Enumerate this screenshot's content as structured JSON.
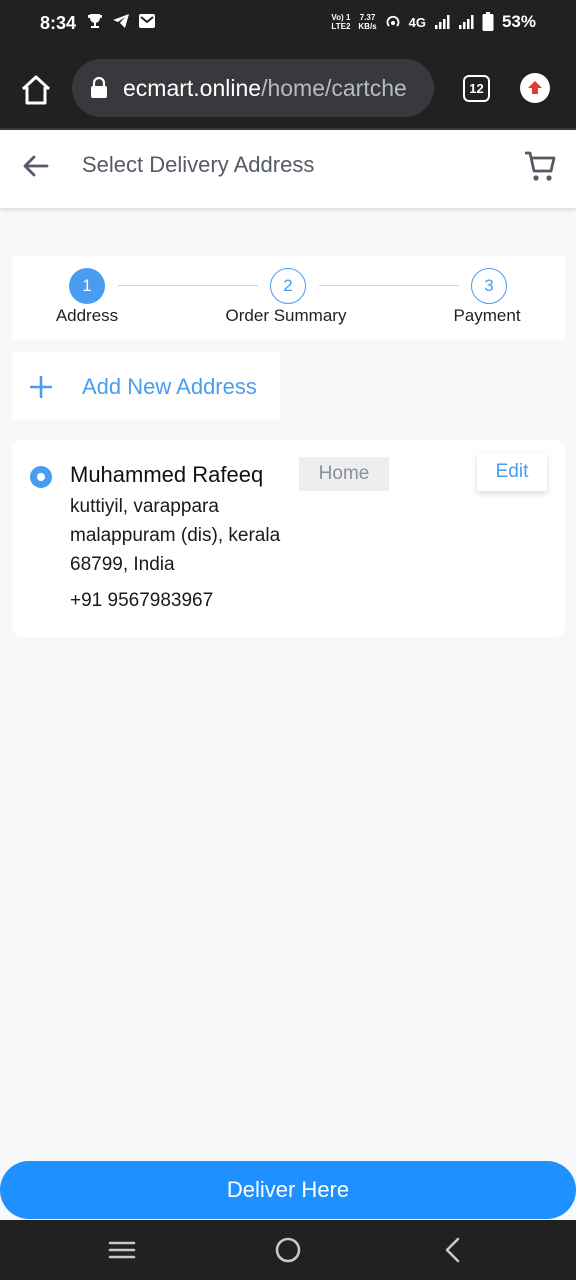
{
  "status_bar": {
    "time": "8:34",
    "volte_top": "Vo) 1",
    "volte_bottom": "LTE2",
    "speed_top": "7.37",
    "speed_bottom": "KB/s",
    "network": "4G",
    "battery": "53%"
  },
  "browser": {
    "url_host": "ecmart.online",
    "url_path": "/home/cartche",
    "tab_count": "12"
  },
  "header": {
    "title": "Select Delivery Address"
  },
  "stepper": {
    "steps": [
      {
        "number": "1",
        "label": "Address",
        "state": "active"
      },
      {
        "number": "2",
        "label": "Order Summary",
        "state": "idle"
      },
      {
        "number": "3",
        "label": "Payment",
        "state": "idle"
      }
    ]
  },
  "add_address": {
    "label": "Add New Address"
  },
  "address": {
    "name": "Muhammed Rafeeq",
    "tag": "Home",
    "edit_label": "Edit",
    "line1": "kuttiyil, varappara",
    "line2": "malappuram (dis), kerala",
    "line3": "68799, India",
    "phone": "+91 9567983967",
    "selected": true
  },
  "footer": {
    "deliver_label": "Deliver Here"
  },
  "colors": {
    "accent": "#4a9cf0",
    "primary_button": "#1e90ff",
    "system_bar": "#212121"
  }
}
